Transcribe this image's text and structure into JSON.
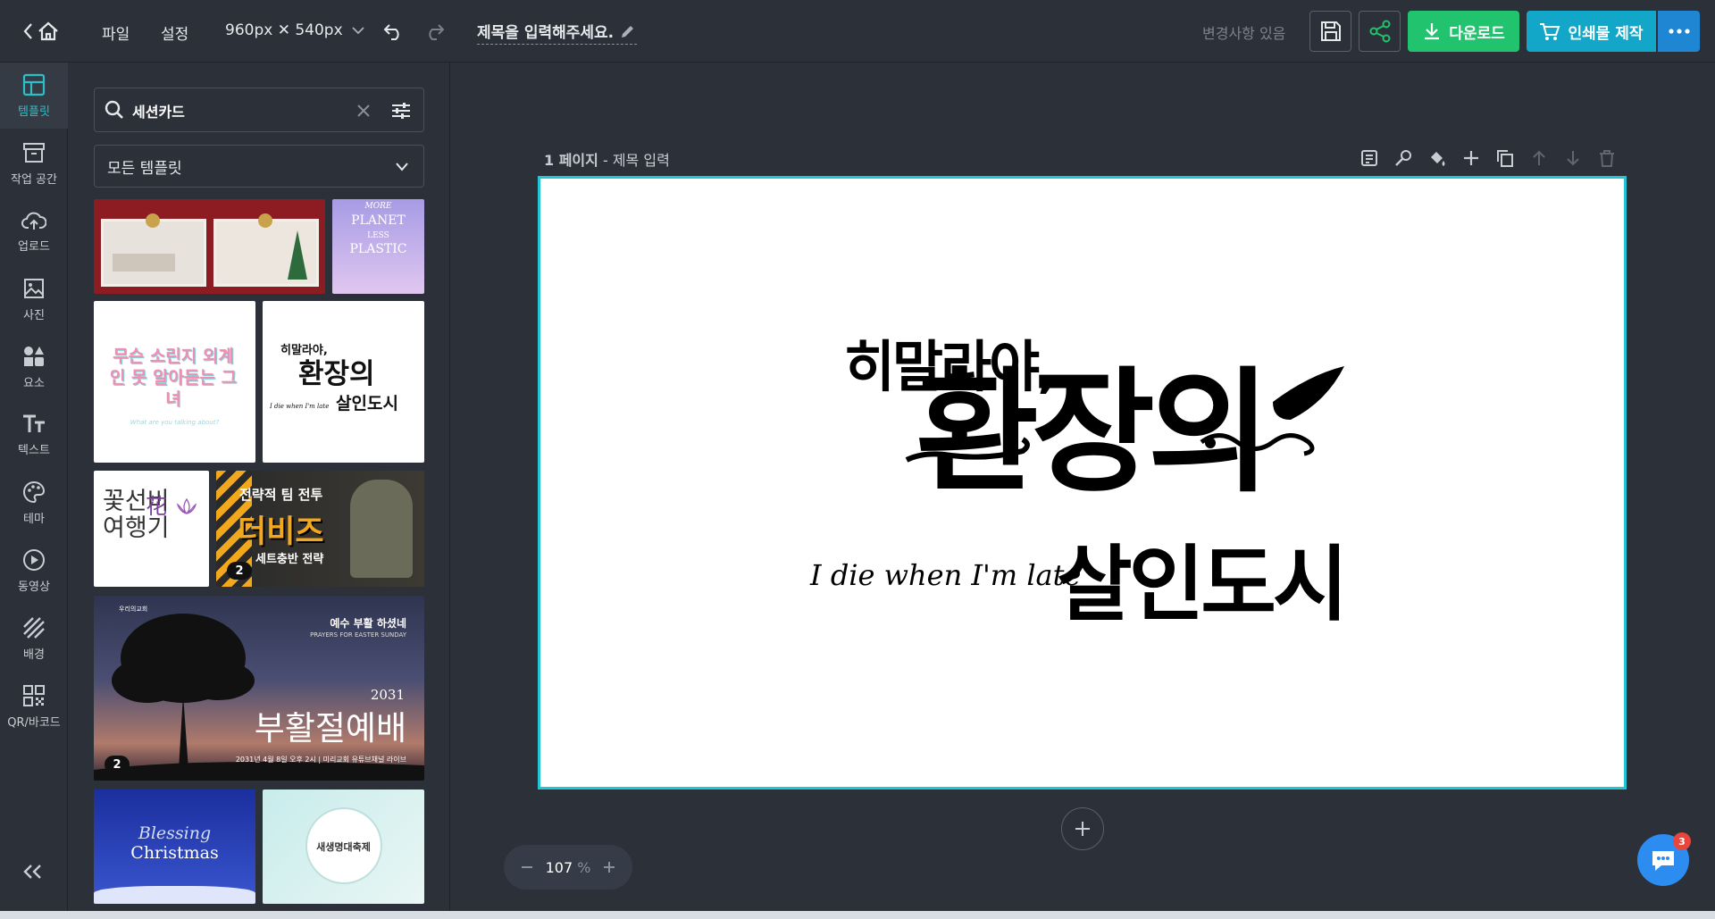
{
  "topbar": {
    "file_menu": "파일",
    "settings_menu": "설정",
    "size_label": "960px ✕ 540px",
    "title": "제목을 입력해주세요.",
    "change_status": "변경사항 있음",
    "download_label": "다운로드",
    "print_label": "인쇄물 제작"
  },
  "sidebar": {
    "items": [
      {
        "label": "템플릿",
        "icon": "template-icon"
      },
      {
        "label": "작업 공간",
        "icon": "archive-icon"
      },
      {
        "label": "업로드",
        "icon": "upload-cloud-icon"
      },
      {
        "label": "사진",
        "icon": "image-icon"
      },
      {
        "label": "요소",
        "icon": "shapes-icon"
      },
      {
        "label": "텍스트",
        "icon": "text-icon"
      },
      {
        "label": "테마",
        "icon": "palette-icon"
      },
      {
        "label": "동영상",
        "icon": "play-icon"
      },
      {
        "label": "배경",
        "icon": "hatch-icon"
      },
      {
        "label": "QR/바코드",
        "icon": "qr-icon"
      }
    ]
  },
  "panel": {
    "search_value": "세션카드",
    "filter_select": "모든 템플릿",
    "thumbs": {
      "planet": [
        "MORE",
        "PLANET",
        "LESS",
        "PLASTIC"
      ],
      "alien_title": "무슨 소린지 외계인 못 알아듣는 그녀",
      "alien_sub": "What are you talking about?",
      "murder_small": "히말라야,",
      "murder_main": "환장의",
      "murder_city": "살인도시",
      "murder_en": "I die when I'm late",
      "flower_main": "꽃선비 여행기",
      "flower_hanja": "花",
      "game_top": "전략적 팀 전투",
      "game_main": "더비즈",
      "game_sub": "세트충반 전략",
      "game_badge": "2",
      "easter_church": "우리의교회",
      "easter_ko": "예수 부활 하셨네",
      "easter_en": "PRAYERS FOR EASTER SUNDAY",
      "easter_year": "2031",
      "easter_title": "부활절예배",
      "easter_info": "2031년 4월 8일 오후 2시 | 미리교회 유튜브채널 라이브",
      "easter_badge": "2",
      "xmas_1": "Blessing",
      "xmas_2": "Christmas",
      "festival": "새생명대축제"
    }
  },
  "canvas": {
    "page_label": "1 페이지",
    "page_title": "제목 입력",
    "design": {
      "line1": "히말라야,",
      "main": "환장의",
      "sub": "살인도시",
      "english": "I die when I'm late"
    }
  },
  "zoom": {
    "value": "107",
    "unit": "%"
  },
  "chat": {
    "badge": "3"
  },
  "colors": {
    "accent": "#2ac0c9",
    "download": "#22c36e",
    "print": "#12a7c8",
    "background": "#2b3039"
  }
}
